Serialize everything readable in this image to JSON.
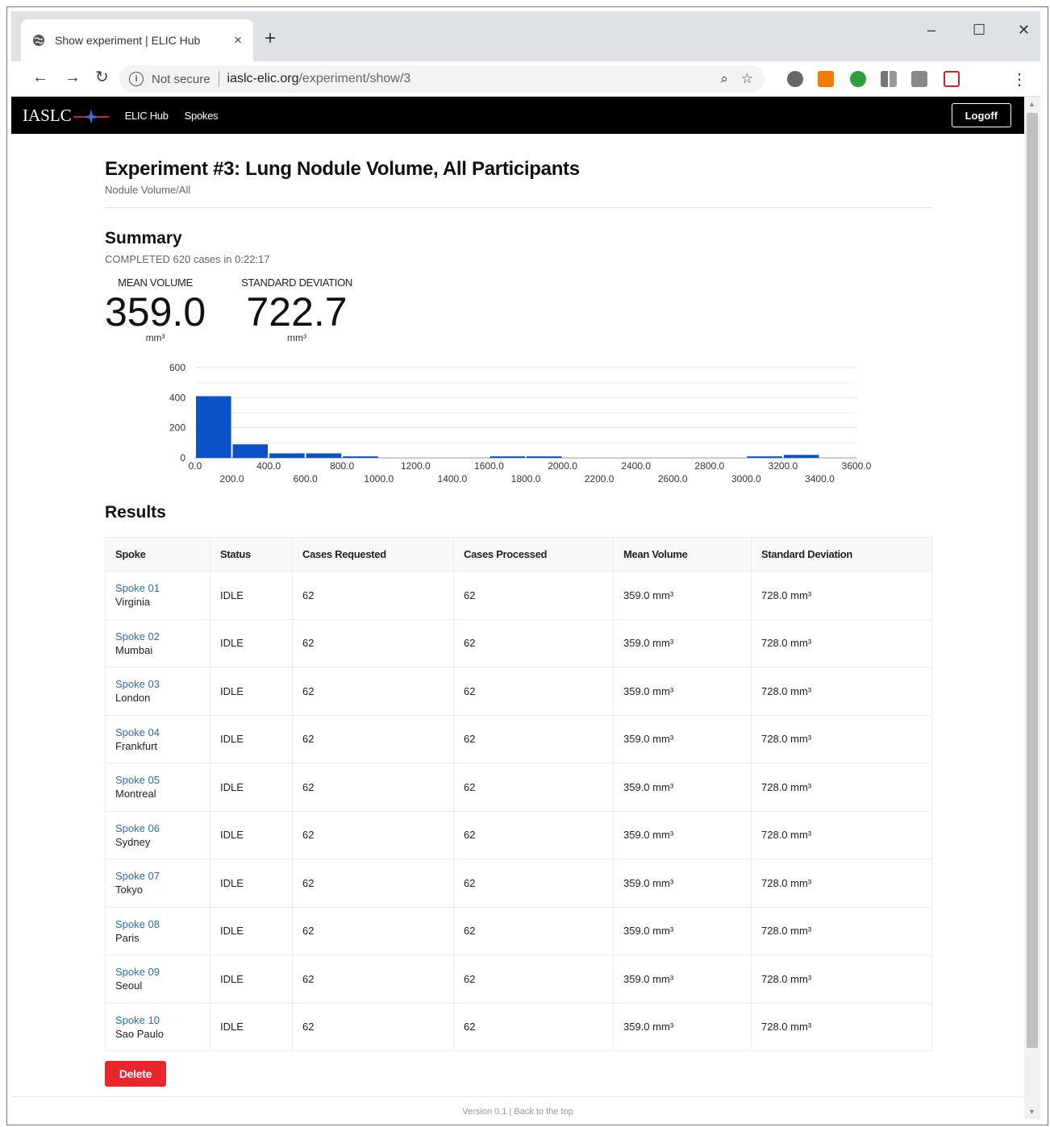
{
  "browser": {
    "tab_title": "Show experiment | ELIC Hub",
    "tab_close": "×",
    "new_tab": "+",
    "not_secure": "Not secure",
    "url_host": "iaslc-elic.org",
    "url_path": "/experiment/show/3",
    "window_controls": {
      "minimize": "–",
      "maximize": "☐",
      "close": "✕"
    }
  },
  "header": {
    "logo_text": "IASLC",
    "nav": [
      "ELIC Hub",
      "Spokes"
    ],
    "logoff": "Logoff"
  },
  "page": {
    "title": "Experiment #3: Lung Nodule Volume, All Participants",
    "subtitle": "Nodule Volume/All"
  },
  "summary": {
    "title": "Summary",
    "status": "COMPLETED 620 cases in 0:22:17",
    "mean_label": "MEAN VOLUME",
    "mean_value": "359.0",
    "mean_unit": "mm³",
    "sd_label": "STANDARD DEVIATION",
    "sd_value": "722.7",
    "sd_unit": "mm³"
  },
  "chart_data": {
    "type": "bar",
    "x_ticks": [
      "0.0",
      "200.0",
      "400.0",
      "600.0",
      "800.0",
      "1000.0",
      "1200.0",
      "1400.0",
      "1600.0",
      "1800.0",
      "2000.0",
      "2200.0",
      "2400.0",
      "2600.0",
      "2800.0",
      "3000.0",
      "3200.0",
      "3400.0",
      "3600.0"
    ],
    "y_ticks": [
      "0",
      "200",
      "400",
      "600"
    ],
    "xlim": [
      0,
      3600
    ],
    "ylim": [
      0,
      600
    ],
    "bin_width": 200,
    "bins": [
      {
        "start": 0,
        "value": 410
      },
      {
        "start": 200,
        "value": 90
      },
      {
        "start": 400,
        "value": 30
      },
      {
        "start": 600,
        "value": 30
      },
      {
        "start": 800,
        "value": 10
      },
      {
        "start": 1600,
        "value": 10
      },
      {
        "start": 1800,
        "value": 10
      },
      {
        "start": 3000,
        "value": 10
      },
      {
        "start": 3200,
        "value": 20
      }
    ],
    "color": "#0a52c8",
    "grid": true
  },
  "results": {
    "title": "Results",
    "columns": [
      "Spoke",
      "Status",
      "Cases Requested",
      "Cases Processed",
      "Mean Volume",
      "Standard Deviation"
    ],
    "rows": [
      {
        "spoke": "Spoke 01",
        "location": "Virginia",
        "status": "IDLE",
        "requested": "62",
        "processed": "62",
        "mean": "359.0 mm³",
        "sd": "728.0 mm³"
      },
      {
        "spoke": "Spoke 02",
        "location": "Mumbai",
        "status": "IDLE",
        "requested": "62",
        "processed": "62",
        "mean": "359.0 mm³",
        "sd": "728.0 mm³"
      },
      {
        "spoke": "Spoke 03",
        "location": "London",
        "status": "IDLE",
        "requested": "62",
        "processed": "62",
        "mean": "359.0 mm³",
        "sd": "728.0 mm³"
      },
      {
        "spoke": "Spoke 04",
        "location": "Frankfurt",
        "status": "IDLE",
        "requested": "62",
        "processed": "62",
        "mean": "359.0 mm³",
        "sd": "728.0 mm³"
      },
      {
        "spoke": "Spoke 05",
        "location": "Montreal",
        "status": "IDLE",
        "requested": "62",
        "processed": "62",
        "mean": "359.0 mm³",
        "sd": "728.0 mm³"
      },
      {
        "spoke": "Spoke 06",
        "location": "Sydney",
        "status": "IDLE",
        "requested": "62",
        "processed": "62",
        "mean": "359.0 mm³",
        "sd": "728.0 mm³"
      },
      {
        "spoke": "Spoke 07",
        "location": "Tokyo",
        "status": "IDLE",
        "requested": "62",
        "processed": "62",
        "mean": "359.0 mm³",
        "sd": "728.0 mm³"
      },
      {
        "spoke": "Spoke 08",
        "location": "Paris",
        "status": "IDLE",
        "requested": "62",
        "processed": "62",
        "mean": "359.0 mm³",
        "sd": "728.0 mm³"
      },
      {
        "spoke": "Spoke 09",
        "location": "Seoul",
        "status": "IDLE",
        "requested": "62",
        "processed": "62",
        "mean": "359.0 mm³",
        "sd": "728.0 mm³"
      },
      {
        "spoke": "Spoke 10",
        "location": "Sao Paulo",
        "status": "IDLE",
        "requested": "62",
        "processed": "62",
        "mean": "359.0 mm³",
        "sd": "728.0 mm³"
      }
    ]
  },
  "actions": {
    "delete": "Delete"
  },
  "footer": {
    "version": "Version 0.1",
    "separator": "|",
    "back_to_top": "Back to the top"
  }
}
